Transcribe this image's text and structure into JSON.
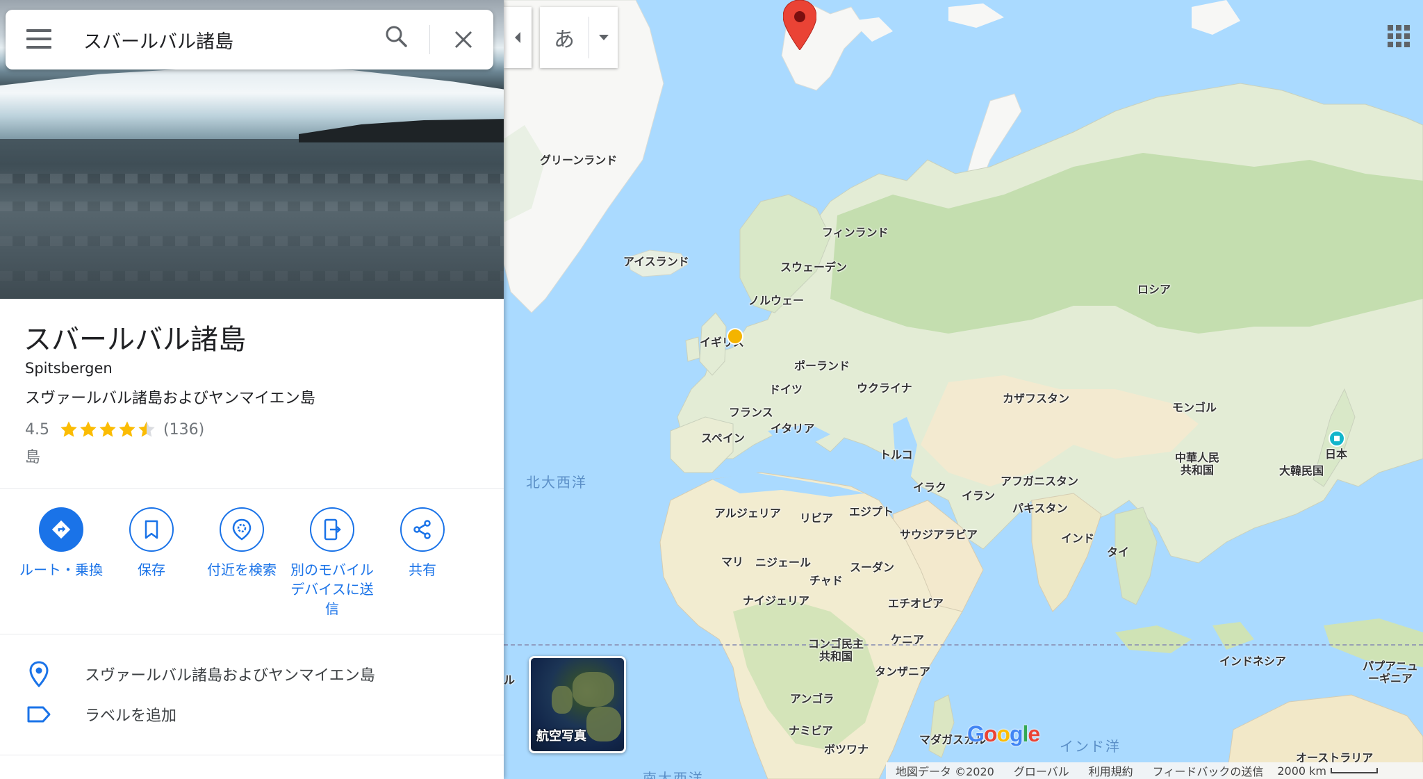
{
  "search": {
    "value": "スバールバル諸島"
  },
  "place": {
    "title": "スバールバル諸島",
    "subtitle": "Spitsbergen",
    "region": "スヴァールバル諸島およびヤンマイエン島",
    "rating": "4.5",
    "rating_value": 4.5,
    "review_count": "(136)",
    "category": "島"
  },
  "actions": [
    {
      "label": "ルート・乗換",
      "icon": "directions-icon"
    },
    {
      "label": "保存",
      "icon": "bookmark-icon"
    },
    {
      "label": "付近を検索",
      "icon": "nearby-icon"
    },
    {
      "label": "別のモバイルデバイスに送信",
      "icon": "send-to-phone-icon"
    },
    {
      "label": "共有",
      "icon": "share-icon"
    }
  ],
  "info_rows": [
    {
      "text": "スヴァールバル諸島およびヤンマイエン島",
      "icon": "location-pin-icon"
    },
    {
      "text": "ラベルを追加",
      "icon": "label-icon"
    }
  ],
  "map": {
    "language_button": "あ",
    "satellite_label": "航空写真",
    "labels": {
      "greenland": "グリーンランド",
      "iceland": "アイスランド",
      "finland": "フィンランド",
      "sweden": "スウェーデン",
      "norway": "ノルウェー",
      "russia": "ロシア",
      "uk": "イギリス",
      "poland": "ポーランド",
      "germany": "ドイツ",
      "ukraine": "ウクライナ",
      "kazakhstan": "カザフスタン",
      "mongolia": "モンゴル",
      "france": "フランス",
      "italy": "イタリア",
      "spain": "スペイン",
      "turkey": "トルコ",
      "afghanistan": "アフガニスタン",
      "china": "中華人民共和国",
      "japan": "日本",
      "korea": "大韓民国",
      "iraq": "イラク",
      "iran": "イラン",
      "pakistan": "パキスタン",
      "algeria": "アルジェリア",
      "libya": "リビア",
      "egypt": "エジプト",
      "saudi": "サウジアラビア",
      "india": "インド",
      "thailand": "タイ",
      "mali": "マリ",
      "niger": "ニジェール",
      "sudan": "スーダン",
      "chad": "チャド",
      "nigeria": "ナイジェリア",
      "ethiopia": "エチオピア",
      "congo": "コンゴ民主共和国",
      "kenya": "ケニア",
      "tanzania": "タンザニア",
      "indonesia": "インドネシア",
      "png": "パプアニューギニア",
      "angola": "アンゴラ",
      "namibia": "ナミビア",
      "botswana": "ボツワナ",
      "madagascar": "マダガスカル",
      "australia": "オーストラリア"
    },
    "oceans": {
      "north_atlantic": "北大西洋",
      "indian": "インド洋",
      "south_atlantic": "南大西洋"
    },
    "partial_labels": {
      "left_edge": "ル"
    },
    "brand": {
      "blue": "#4285f4",
      "red": "#ea4335",
      "yellow": "#fbbc05",
      "green": "#34a853"
    },
    "accent": "#1a73e8",
    "pin_color": "#ea4335"
  },
  "footer": {
    "map_data": "地図データ ©2020",
    "global": "グローバル",
    "terms": "利用規約",
    "feedback": "フィードバックの送信",
    "scale": "2000 km"
  }
}
